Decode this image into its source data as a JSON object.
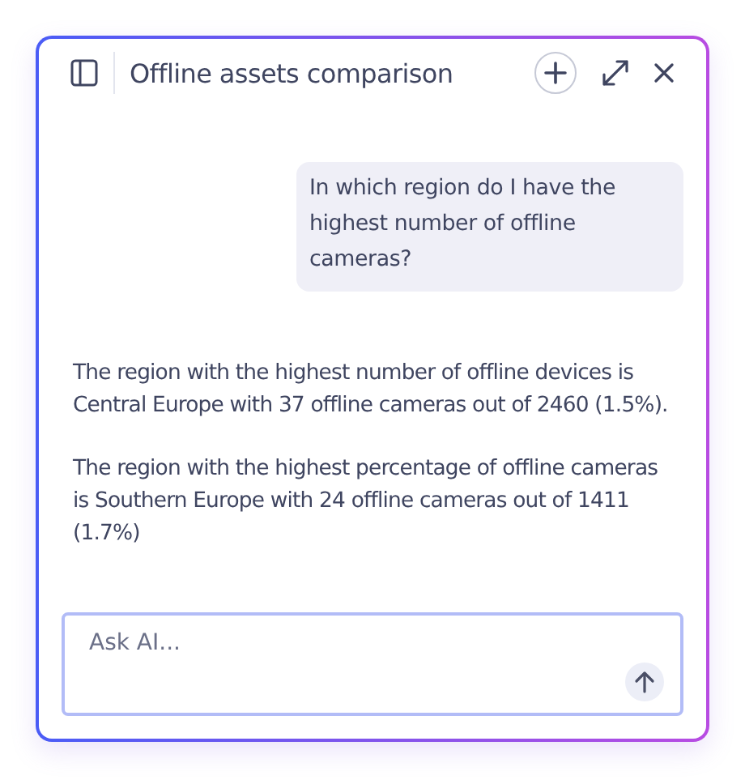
{
  "header": {
    "title": "Offline assets comparison"
  },
  "messages": [
    {
      "kind": "user",
      "paragraphs": [
        "In which region do I have the highest number of offline cameras?"
      ]
    },
    {
      "kind": "assistant",
      "paragraphs": [
        "The region with the highest number of offline devices is Central Europe with 37 offline cameras out of 2460 (1.5%).",
        "The region with the highest percentage of offline cameras is Southern Europe with 24 offline cameras out of 1411 (1.7%)"
      ]
    }
  ],
  "composer": {
    "placeholder": "Ask AI..."
  }
}
